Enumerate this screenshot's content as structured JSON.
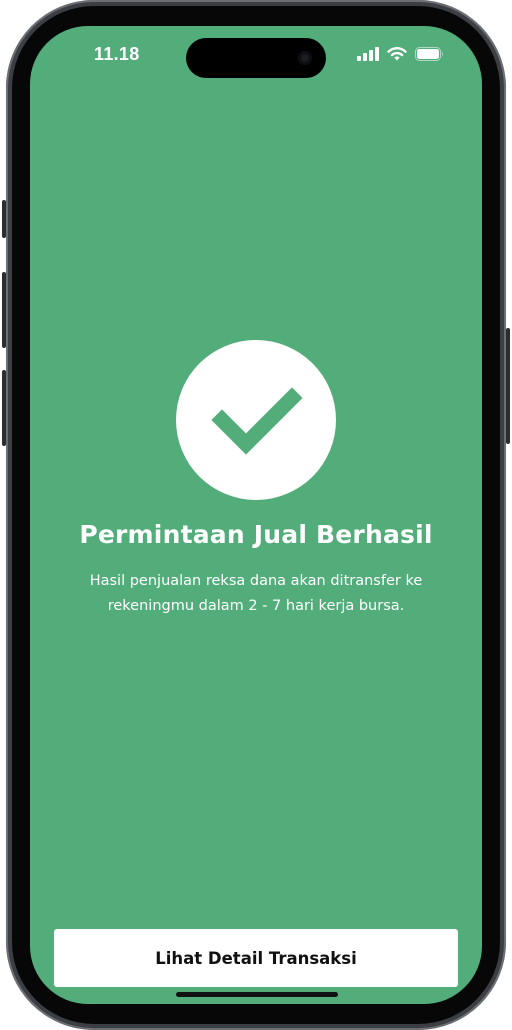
{
  "status_bar": {
    "time": "11.18",
    "signal_icon": "cellular-signal-icon",
    "wifi_icon": "wifi-icon",
    "battery_icon": "battery-icon"
  },
  "success": {
    "icon": "checkmark-icon",
    "title": "Permintaan Jual Berhasil",
    "message": "Hasil penjualan reksa dana akan ditransfer ke rekeningmu dalam 2 - 7 hari kerja bursa."
  },
  "actions": {
    "detail_label": "Lihat Detail Transaksi"
  },
  "colors": {
    "background": "#52ad7b",
    "accent_check": "#52ad7b",
    "button_bg": "#ffffff",
    "button_text": "#111111"
  }
}
